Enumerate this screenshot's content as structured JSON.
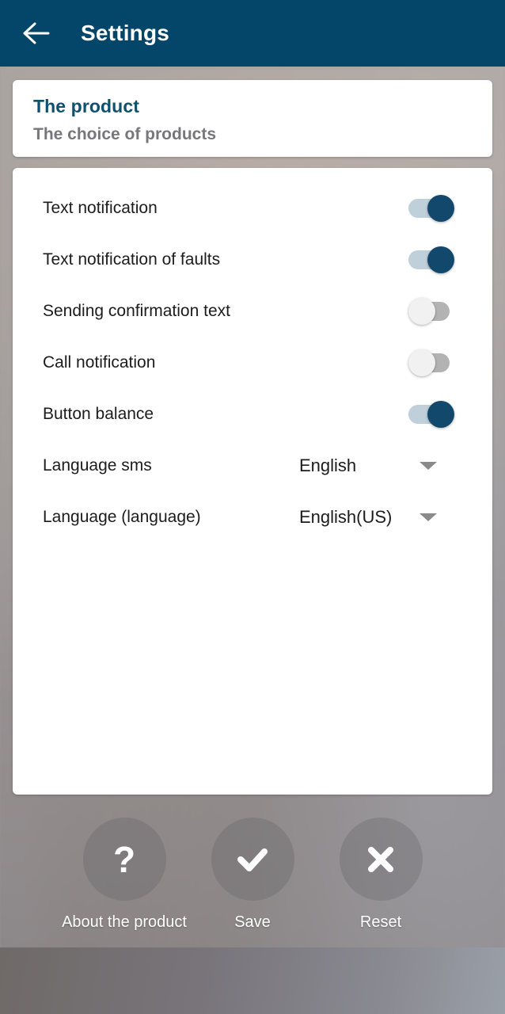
{
  "appbar": {
    "back_icon": "arrow-left-icon",
    "title": "Settings",
    "background_color": "#04456a",
    "title_color": "#ffffff"
  },
  "product_card": {
    "title": "The product",
    "subtitle": "The choice of products",
    "title_color": "#10506f",
    "subtitle_color": "#77777a"
  },
  "settings": {
    "toggle_rows": [
      {
        "label": "Text notification",
        "state": "on"
      },
      {
        "label": "Text notification of faults",
        "state": "on"
      },
      {
        "label": "Sending confirmation text",
        "state": "off"
      },
      {
        "label": "Call notification",
        "state": "off"
      },
      {
        "label": "Button balance",
        "state": "on"
      }
    ],
    "spinner_rows": [
      {
        "label": "Language sms",
        "value": "English",
        "caret_icon": "chevron-down-icon"
      },
      {
        "label": "Language (language)",
        "value": "English(US)",
        "caret_icon": "chevron-down-icon"
      }
    ],
    "toggle_on_track_color": "#c0d0da",
    "toggle_on_thumb_color": "#12486b",
    "toggle_off_track_color": "#b3b3b3",
    "toggle_off_thumb_color": "#f1f1f1"
  },
  "actions": [
    {
      "icon": "question-mark-icon",
      "glyph": "?",
      "label": "About the product"
    },
    {
      "icon": "check-icon",
      "glyph": "✓",
      "label": "Save"
    },
    {
      "icon": "close-icon",
      "glyph": "✕",
      "label": "Reset"
    }
  ]
}
